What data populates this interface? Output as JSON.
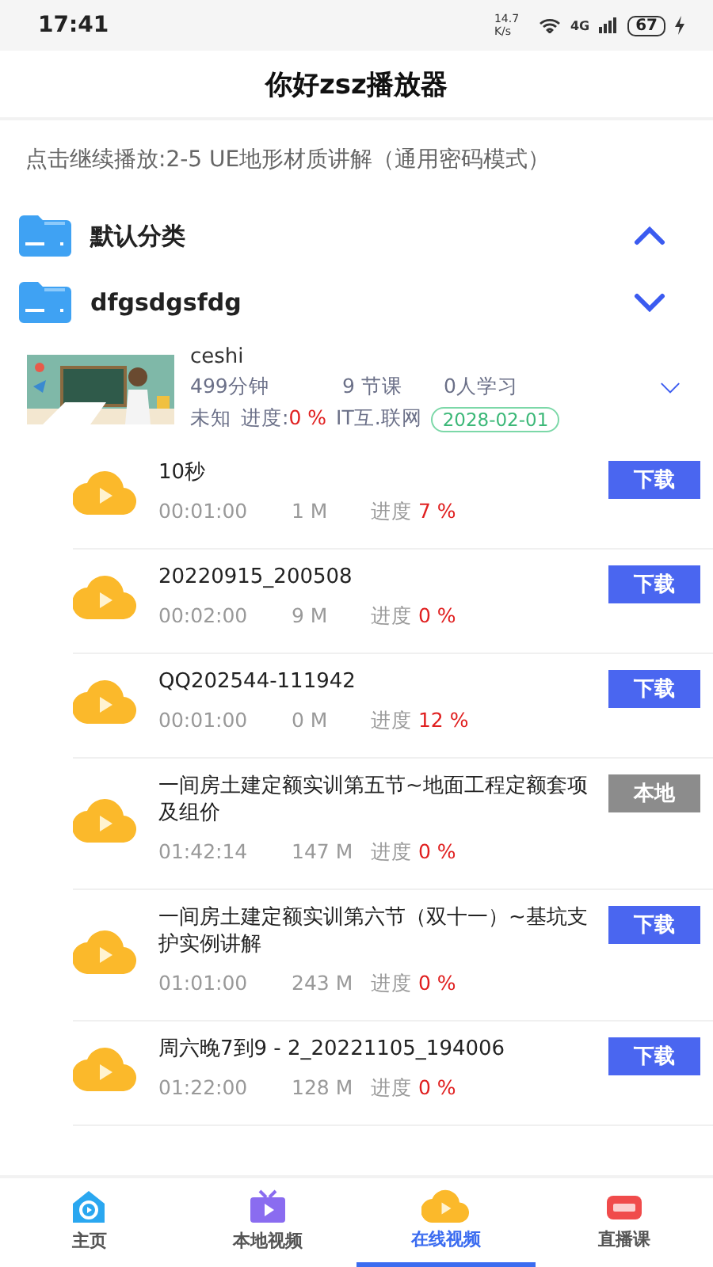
{
  "status_bar": {
    "time": "17:41",
    "speed": "14.7 K/s",
    "network": "4G",
    "battery": "67"
  },
  "header": {
    "title": "你好zsz播放器"
  },
  "resume": {
    "text": "点击继续播放:2-5 UE地形材质讲解（通用密码模式）"
  },
  "categories": [
    {
      "name": "默认分类",
      "expanded": true
    },
    {
      "name": "dfgsdgsfdg",
      "expanded": false
    }
  ],
  "course": {
    "title": "ceshi",
    "duration": "499分钟",
    "lessons": "9 节课",
    "learners": "0人学习",
    "status": "未知",
    "progress_label": "进度:",
    "progress": "0 %",
    "category": "IT互.联网",
    "date": "2028-02-01"
  },
  "videos": [
    {
      "title": "10秒",
      "duration": "00:01:00",
      "size": "1 M",
      "progress_label": "进度",
      "progress": "7 %",
      "action": {
        "kind": "download",
        "label": "下载"
      }
    },
    {
      "title": "20220915_200508",
      "duration": "00:02:00",
      "size": "9 M",
      "progress_label": "进度",
      "progress": "0 %",
      "action": {
        "kind": "download",
        "label": "下载"
      }
    },
    {
      "title": "QQ202544-111942",
      "duration": "00:01:00",
      "size": "0 M",
      "progress_label": "进度",
      "progress": "12 %",
      "action": {
        "kind": "download",
        "label": "下载"
      }
    },
    {
      "title": "一间房土建定额实训第五节~地面工程定额套项及组价",
      "duration": "01:42:14",
      "size": "147 M",
      "progress_label": "进度",
      "progress": "0 %",
      "action": {
        "kind": "local",
        "label": "本地"
      }
    },
    {
      "title": "一间房土建定额实训第六节（双十一）~基坑支护实例讲解",
      "duration": "01:01:00",
      "size": "243 M",
      "progress_label": "进度",
      "progress": "0 %",
      "action": {
        "kind": "download",
        "label": "下载"
      }
    },
    {
      "title": "周六晚7到9 - 2_20221105_194006",
      "duration": "01:22:00",
      "size": "128 M",
      "progress_label": "进度",
      "progress": "0 %",
      "action": {
        "kind": "download",
        "label": "下载"
      }
    }
  ],
  "tabs": [
    {
      "label": "主页",
      "kind": "home",
      "selected": false
    },
    {
      "label": "本地视频",
      "kind": "local",
      "selected": false
    },
    {
      "label": "在线视频",
      "kind": "online",
      "selected": true
    },
    {
      "label": "直播课",
      "kind": "live",
      "selected": false
    }
  ]
}
